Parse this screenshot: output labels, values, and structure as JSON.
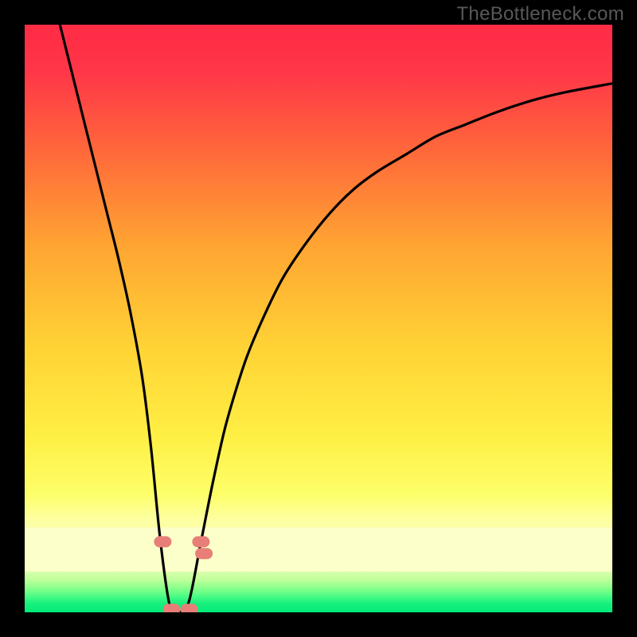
{
  "watermark": "TheBottleneck.com",
  "chart_data": {
    "type": "line",
    "title": "",
    "xlabel": "",
    "ylabel": "",
    "xlim": [
      0,
      100
    ],
    "ylim": [
      0,
      100
    ],
    "grid": false,
    "legend": false,
    "series": [
      {
        "name": "bottleneck-curve",
        "color": "#000000",
        "x": [
          6,
          8,
          10,
          12,
          14,
          16,
          18,
          20,
          21.5,
          23,
          24.5,
          25.5,
          26.5,
          28,
          30,
          32,
          34,
          36,
          38,
          41,
          44,
          48,
          52,
          56,
          60,
          65,
          70,
          75,
          80,
          86,
          92,
          100
        ],
        "y": [
          100,
          92,
          84,
          76,
          68,
          60,
          51,
          40,
          28,
          13,
          2,
          0,
          0,
          2,
          12,
          22,
          31,
          38,
          44,
          51,
          57,
          63,
          68,
          72,
          75,
          78,
          81,
          83,
          85,
          87,
          88.5,
          90
        ]
      }
    ],
    "markers": [
      {
        "name": "dip-left-marker",
        "x": 23.5,
        "y": 12,
        "color": "#e77f78"
      },
      {
        "name": "dip-right-marker",
        "x": 30.0,
        "y": 12,
        "color": "#e77f78"
      },
      {
        "name": "dip-right-marker-2",
        "x": 30.5,
        "y": 10,
        "color": "#e77f78"
      },
      {
        "name": "bottom-marker-1",
        "x": 25.0,
        "y": 0.5,
        "color": "#e77f78"
      },
      {
        "name": "bottom-marker-2",
        "x": 28.0,
        "y": 0.5,
        "color": "#e77f78"
      }
    ],
    "colors": {
      "gradient_top": "#ff2b45",
      "gradient_mid_upper": "#ff9a2a",
      "gradient_mid": "#ffe337",
      "gradient_band_pale": "#fdffa8",
      "gradient_band_light": "#d9ff6a",
      "gradient_band_mint": "#7eff8e",
      "gradient_bottom": "#00ea7a",
      "frame": "#000000"
    }
  }
}
